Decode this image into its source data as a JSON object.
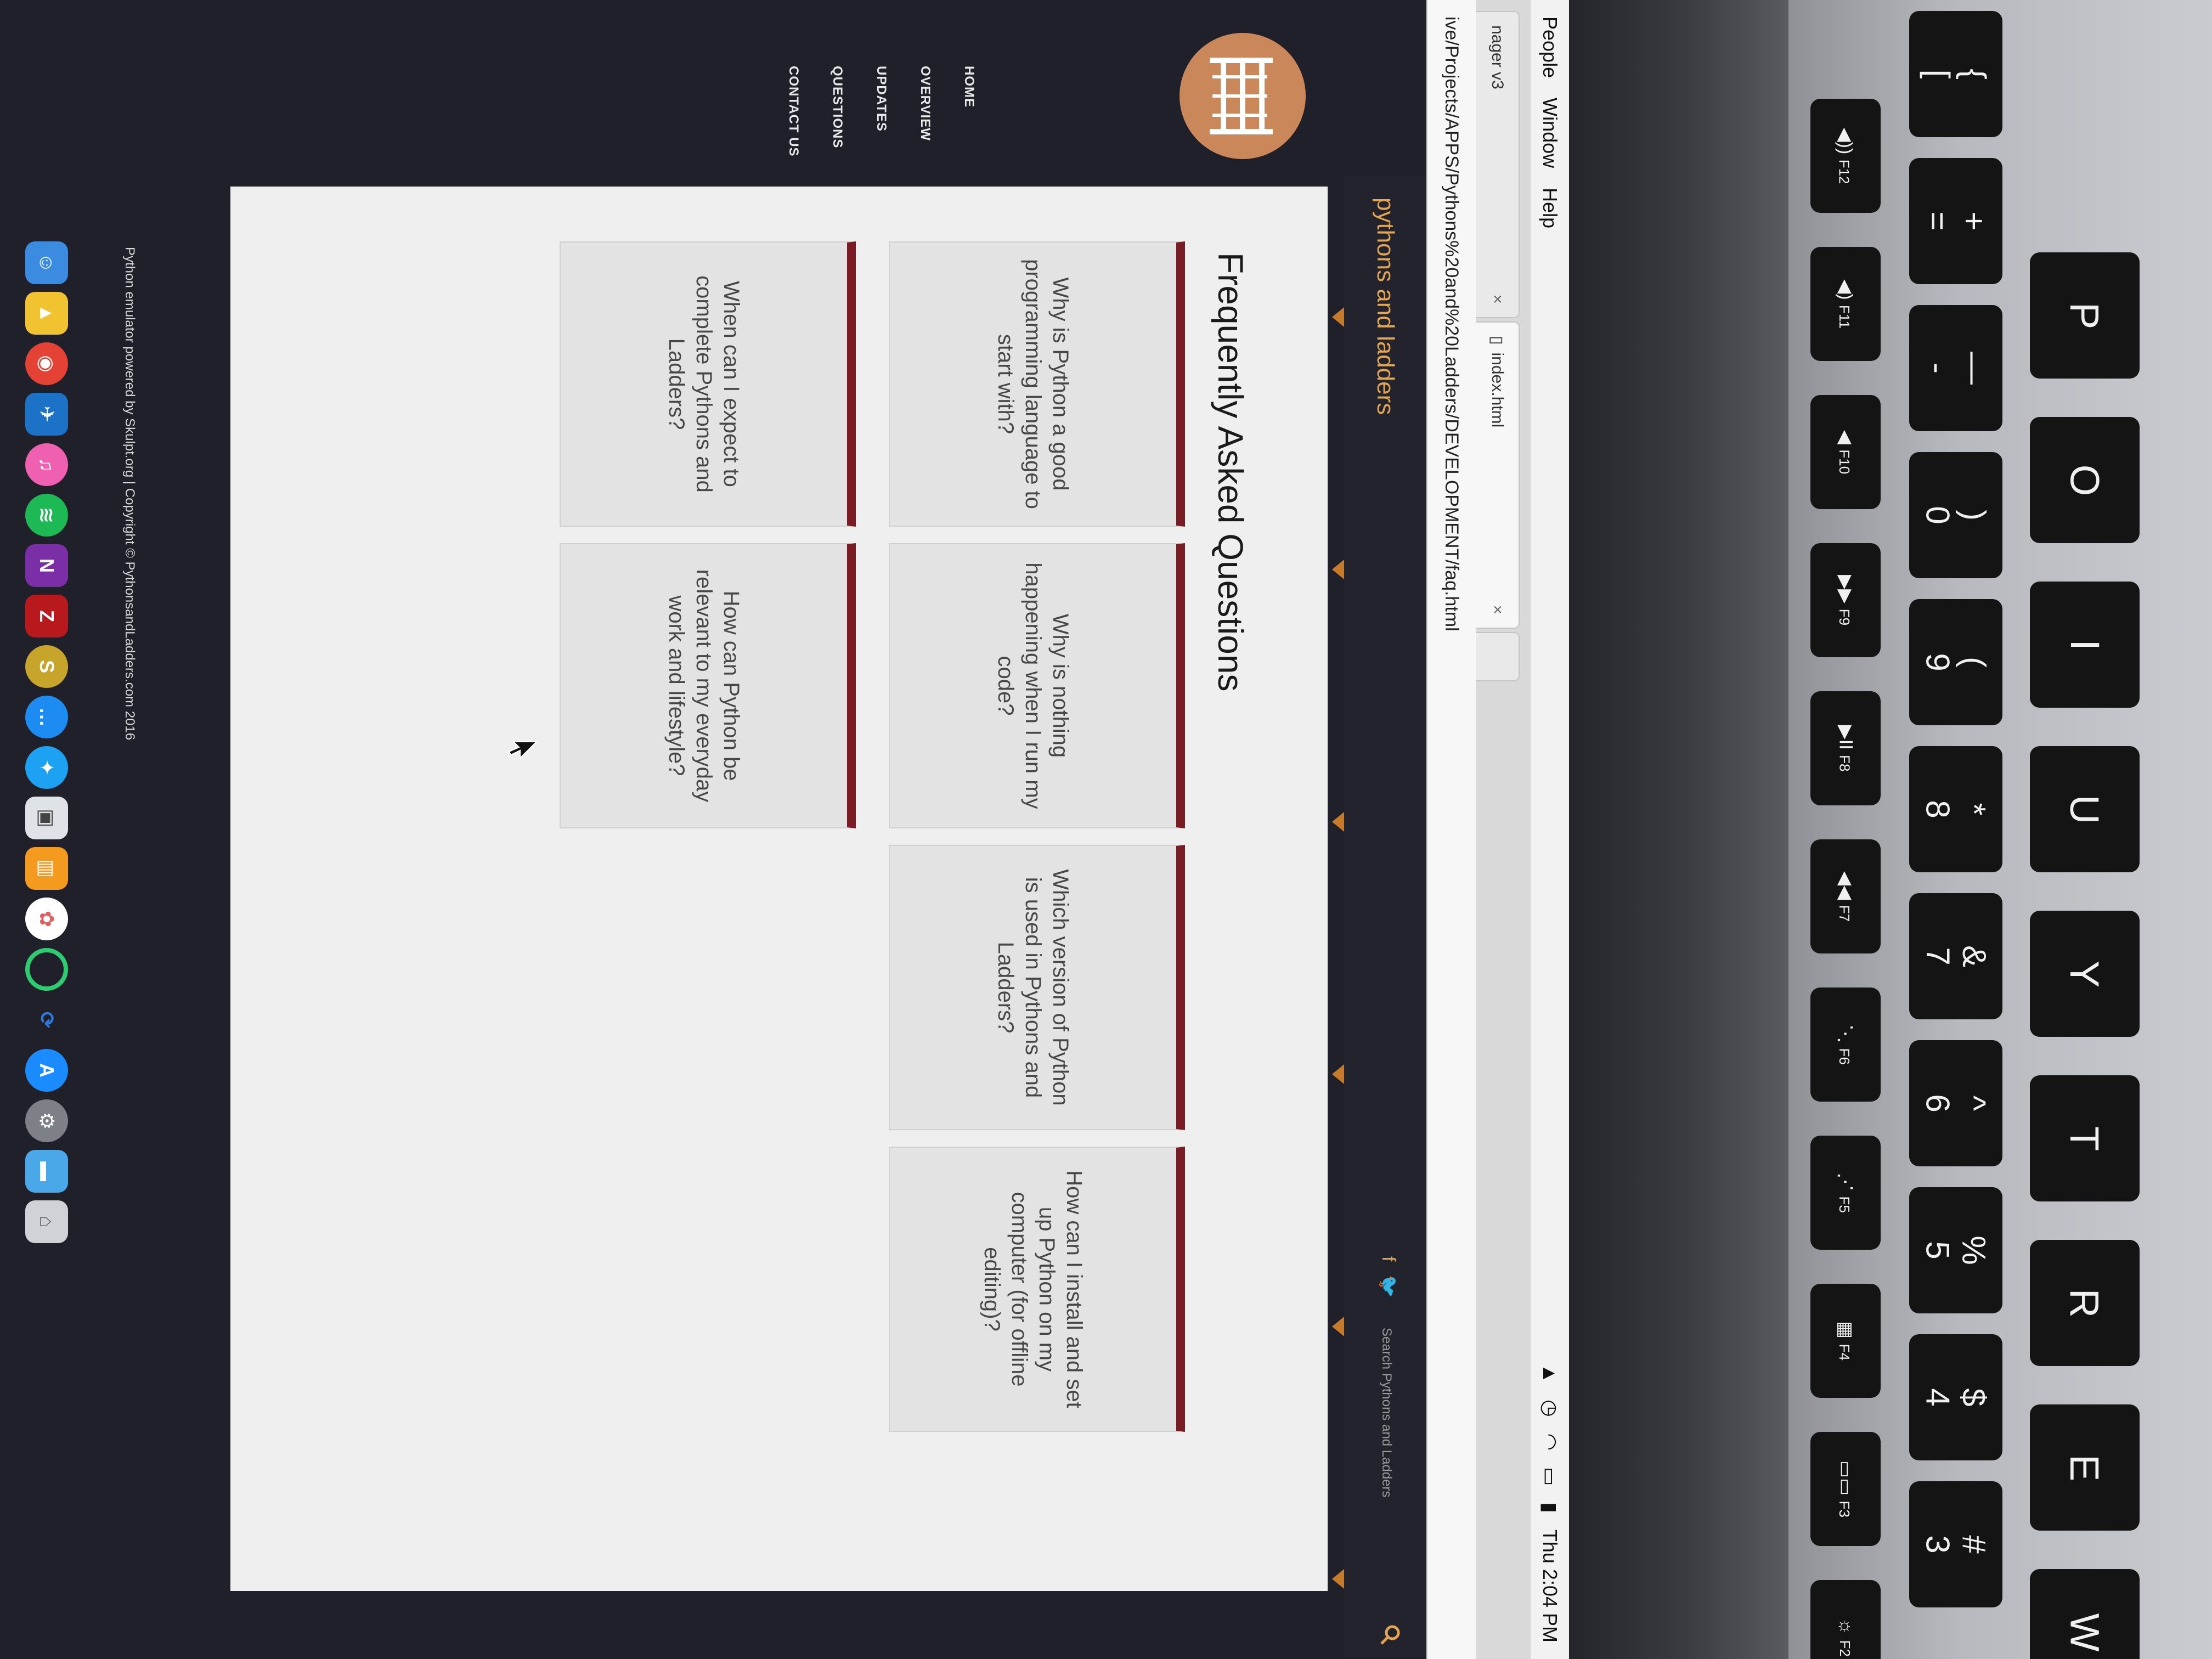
{
  "menubar": {
    "items": [
      "People",
      "Window",
      "Help"
    ],
    "clock": "Thu 2:04 PM"
  },
  "browser": {
    "tabs": [
      {
        "label": "nager v3"
      },
      {
        "label": "index.html"
      },
      {
        "label": ""
      }
    ],
    "url": "ive/Projects/APPS/Pythons%20and%20Ladders/DEVELOPMENT/faq.html"
  },
  "site": {
    "title": "pythons and ladders",
    "nav": [
      "HOME",
      "OVERVIEW",
      "UPDATES",
      "QUESTIONS",
      "CONTACT US"
    ],
    "search_placeholder": "Search Pythons and Ladders",
    "social": {
      "facebook": "f",
      "twitter": "🐦"
    }
  },
  "faq": {
    "heading": "Frequently Asked Questions",
    "questions": [
      "Why is Python a good programming language to start with?",
      "Why is nothing happening when I run my code?",
      "Which version of Python is used in Pythons and Ladders?",
      "How can I install and set up Python on my computer (for offline editing)?",
      "When can I expect to complete Pythons and Ladders?",
      "How can Python be relevant to my everyday work and lifestyle?"
    ]
  },
  "footer": {
    "text": "Python emulator powered by Skulpt.org | Copyright © PythonsandLadders.com 2016"
  },
  "dock_icons": [
    "finder-icon",
    "drive-icon",
    "chrome-icon",
    "xcode-icon",
    "itunes-icon",
    "spotify-icon",
    "onenote-icon",
    "filezilla-icon",
    "skype-icon",
    "messages-icon",
    "twitter-icon",
    "preview-icon",
    "ibooks-icon",
    "photos-icon",
    "circle-app-icon",
    "sync-icon",
    "appstore-icon",
    "system-preferences-icon",
    "folder-icon",
    "trash-icon"
  ],
  "keyboard": {
    "fkeys": [
      {
        "label": "F2",
        "icon": "☼"
      },
      {
        "label": "F3",
        "icon": "▭▭"
      },
      {
        "label": "F4",
        "icon": "▦"
      },
      {
        "label": "F5",
        "icon": "⋰"
      },
      {
        "label": "F6",
        "icon": "⋱"
      },
      {
        "label": "F7",
        "icon": "◀◀"
      },
      {
        "label": "F8",
        "icon": "▶II"
      },
      {
        "label": "F9",
        "icon": "▶▶"
      },
      {
        "label": "F10",
        "icon": "◀"
      },
      {
        "label": "F11",
        "icon": "◀)"
      },
      {
        "label": "F12",
        "icon": "◀))"
      }
    ],
    "numbers": [
      {
        "top": "#",
        "bottom": "3"
      },
      {
        "top": "$",
        "bottom": "4"
      },
      {
        "top": "%",
        "bottom": "5"
      },
      {
        "top": "^",
        "bottom": "6"
      },
      {
        "top": "&",
        "bottom": "7"
      },
      {
        "top": "*",
        "bottom": "8"
      },
      {
        "top": "(",
        "bottom": "9"
      },
      {
        "top": ")",
        "bottom": "0"
      },
      {
        "top": "—",
        "bottom": "-"
      },
      {
        "top": "+",
        "bottom": "="
      },
      {
        "top": "{",
        "bottom": "["
      },
      {
        "top": "}",
        "bottom": "]"
      }
    ],
    "letters": [
      "W",
      "E",
      "R",
      "T",
      "Y",
      "U",
      "I",
      "O",
      "P"
    ]
  }
}
